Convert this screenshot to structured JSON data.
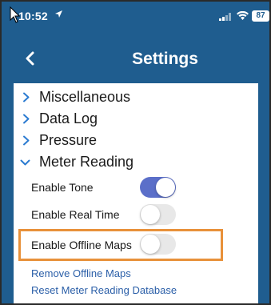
{
  "status_bar": {
    "time": "10:52",
    "battery": "87"
  },
  "nav": {
    "title": "Settings"
  },
  "sections": [
    {
      "label": "Miscellaneous",
      "expanded": false
    },
    {
      "label": "Data Log",
      "expanded": false
    },
    {
      "label": "Pressure",
      "expanded": false
    },
    {
      "label": "Meter Reading",
      "expanded": true
    }
  ],
  "settings": [
    {
      "label": "Enable Tone",
      "on": true
    },
    {
      "label": "Enable Real Time",
      "on": false
    },
    {
      "label": "Enable Offline Maps",
      "on": false
    }
  ],
  "links": {
    "remove_offline_maps": "Remove Offline Maps",
    "reset_database": "Reset Meter Reading Database"
  },
  "colors": {
    "nav_background": "#1f5d8f",
    "toggle_on": "#5b6fc9",
    "toggle_off": "#e8e8e8",
    "highlight": "#e8913a",
    "link": "#2b5fa8"
  }
}
